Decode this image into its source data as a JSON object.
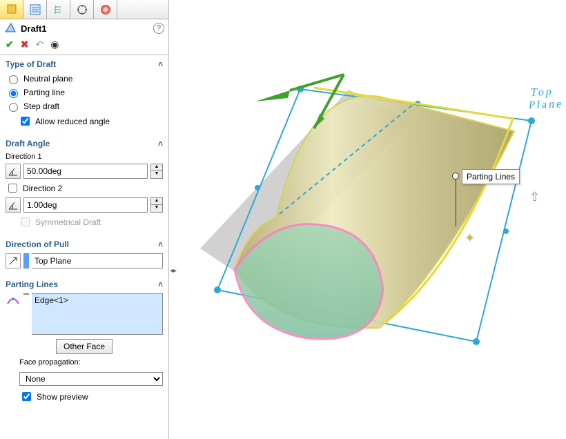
{
  "tabs": [
    "feature",
    "detail",
    "tree",
    "target",
    "appearance"
  ],
  "header": {
    "title": "Draft1"
  },
  "type_of_draft": {
    "header": "Type of Draft",
    "options": {
      "neutral": "Neutral plane",
      "parting": "Parting line",
      "step": "Step draft"
    },
    "selected": "parting",
    "allow_reduced": {
      "label": "Allow reduced angle",
      "checked": true
    }
  },
  "draft_angle": {
    "header": "Draft Angle",
    "direction1_label": "Direction 1",
    "direction1_value": "50.00deg",
    "direction2_checked": false,
    "direction2_label": "Direction 2",
    "direction2_value": "1.00deg",
    "symmetrical_label": "Symmetrical Draft",
    "symmetrical_checked": false
  },
  "direction_of_pull": {
    "header": "Direction of Pull",
    "value": "Top Plane"
  },
  "parting_lines": {
    "header": "Parting Lines",
    "items": [
      "Edge<1>"
    ],
    "other_face_label": "Other Face",
    "face_prop_label": "Face propagation:",
    "face_prop_value": "None",
    "show_preview_label": "Show preview",
    "show_preview_checked": true
  },
  "callout": {
    "label": "Parting Lines"
  },
  "plane_label": "Top Plane"
}
